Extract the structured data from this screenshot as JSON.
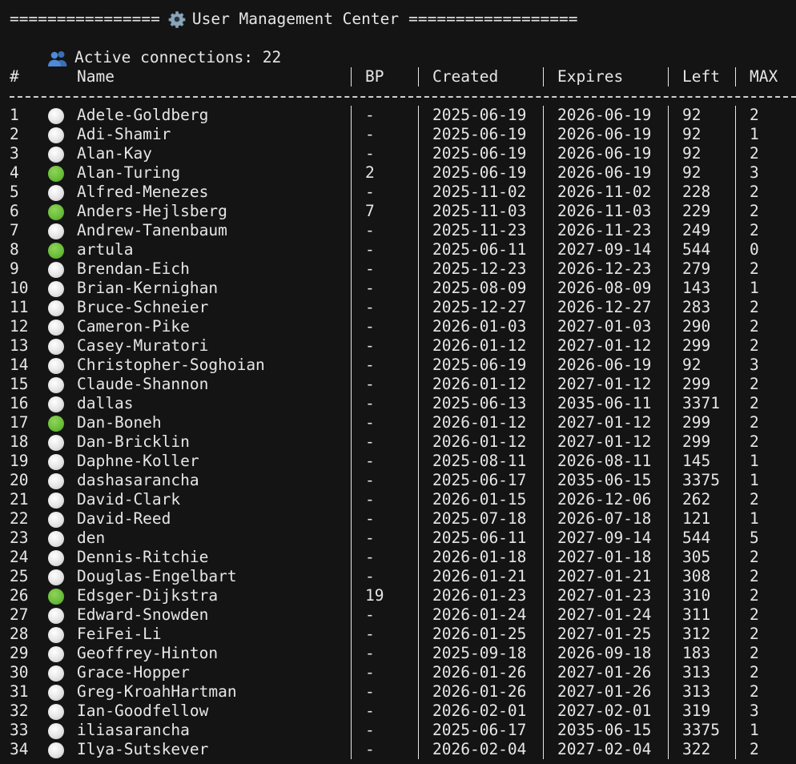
{
  "banner": {
    "left_bar": "================",
    "title": "User Management Center",
    "right_bar": "=================="
  },
  "status": {
    "text": "Active connections: 22"
  },
  "table": {
    "headers": {
      "index": "#",
      "name": "Name",
      "bp": "BP",
      "created": "Created",
      "expires": "Expires",
      "left": "Left",
      "max": "MAX"
    },
    "colors": {
      "online": "#6bbf3a",
      "offline": "#e4e4e4"
    },
    "rows": [
      {
        "idx": "1",
        "status": "offline",
        "name": "Adele-Goldberg",
        "bp": "-",
        "created": "2025-06-19",
        "expires": "2026-06-19",
        "left": "92",
        "max": "2"
      },
      {
        "idx": "2",
        "status": "offline",
        "name": "Adi-Shamir",
        "bp": "-",
        "created": "2025-06-19",
        "expires": "2026-06-19",
        "left": "92",
        "max": "1"
      },
      {
        "idx": "3",
        "status": "offline",
        "name": "Alan-Kay",
        "bp": "-",
        "created": "2025-06-19",
        "expires": "2026-06-19",
        "left": "92",
        "max": "2"
      },
      {
        "idx": "4",
        "status": "online",
        "name": "Alan-Turing",
        "bp": "2",
        "created": "2025-06-19",
        "expires": "2026-06-19",
        "left": "92",
        "max": "3"
      },
      {
        "idx": "5",
        "status": "offline",
        "name": "Alfred-Menezes",
        "bp": "-",
        "created": "2025-11-02",
        "expires": "2026-11-02",
        "left": "228",
        "max": "2"
      },
      {
        "idx": "6",
        "status": "online",
        "name": "Anders-Hejlsberg",
        "bp": "7",
        "created": "2025-11-03",
        "expires": "2026-11-03",
        "left": "229",
        "max": "2"
      },
      {
        "idx": "7",
        "status": "offline",
        "name": "Andrew-Tanenbaum",
        "bp": "-",
        "created": "2025-11-23",
        "expires": "2026-11-23",
        "left": "249",
        "max": "2"
      },
      {
        "idx": "8",
        "status": "online",
        "name": "artula",
        "bp": "-",
        "created": "2025-06-11",
        "expires": "2027-09-14",
        "left": "544",
        "max": "0"
      },
      {
        "idx": "9",
        "status": "offline",
        "name": "Brendan-Eich",
        "bp": "-",
        "created": "2025-12-23",
        "expires": "2026-12-23",
        "left": "279",
        "max": "2"
      },
      {
        "idx": "10",
        "status": "offline",
        "name": "Brian-Kernighan",
        "bp": "-",
        "created": "2025-08-09",
        "expires": "2026-08-09",
        "left": "143",
        "max": "1"
      },
      {
        "idx": "11",
        "status": "offline",
        "name": "Bruce-Schneier",
        "bp": "-",
        "created": "2025-12-27",
        "expires": "2026-12-27",
        "left": "283",
        "max": "2"
      },
      {
        "idx": "12",
        "status": "offline",
        "name": "Cameron-Pike",
        "bp": "-",
        "created": "2026-01-03",
        "expires": "2027-01-03",
        "left": "290",
        "max": "2"
      },
      {
        "idx": "13",
        "status": "offline",
        "name": "Casey-Muratori",
        "bp": "-",
        "created": "2026-01-12",
        "expires": "2027-01-12",
        "left": "299",
        "max": "2"
      },
      {
        "idx": "14",
        "status": "offline",
        "name": "Christopher-Soghoian",
        "bp": "-",
        "created": "2025-06-19",
        "expires": "2026-06-19",
        "left": "92",
        "max": "3"
      },
      {
        "idx": "15",
        "status": "offline",
        "name": "Claude-Shannon",
        "bp": "-",
        "created": "2026-01-12",
        "expires": "2027-01-12",
        "left": "299",
        "max": "2"
      },
      {
        "idx": "16",
        "status": "offline",
        "name": "dallas",
        "bp": "-",
        "created": "2025-06-13",
        "expires": "2035-06-11",
        "left": "3371",
        "max": "2"
      },
      {
        "idx": "17",
        "status": "online",
        "name": "Dan-Boneh",
        "bp": "-",
        "created": "2026-01-12",
        "expires": "2027-01-12",
        "left": "299",
        "max": "2"
      },
      {
        "idx": "18",
        "status": "offline",
        "name": "Dan-Bricklin",
        "bp": "-",
        "created": "2026-01-12",
        "expires": "2027-01-12",
        "left": "299",
        "max": "2"
      },
      {
        "idx": "19",
        "status": "offline",
        "name": "Daphne-Koller",
        "bp": "-",
        "created": "2025-08-11",
        "expires": "2026-08-11",
        "left": "145",
        "max": "1"
      },
      {
        "idx": "20",
        "status": "offline",
        "name": "dashasarancha",
        "bp": "-",
        "created": "2025-06-17",
        "expires": "2035-06-15",
        "left": "3375",
        "max": "1"
      },
      {
        "idx": "21",
        "status": "offline",
        "name": "David-Clark",
        "bp": "-",
        "created": "2026-01-15",
        "expires": "2026-12-06",
        "left": "262",
        "max": "2"
      },
      {
        "idx": "22",
        "status": "offline",
        "name": "David-Reed",
        "bp": "-",
        "created": "2025-07-18",
        "expires": "2026-07-18",
        "left": "121",
        "max": "1"
      },
      {
        "idx": "23",
        "status": "offline",
        "name": "den",
        "bp": "-",
        "created": "2025-06-11",
        "expires": "2027-09-14",
        "left": "544",
        "max": "5"
      },
      {
        "idx": "24",
        "status": "offline",
        "name": "Dennis-Ritchie",
        "bp": "-",
        "created": "2026-01-18",
        "expires": "2027-01-18",
        "left": "305",
        "max": "2"
      },
      {
        "idx": "25",
        "status": "offline",
        "name": "Douglas-Engelbart",
        "bp": "-",
        "created": "2026-01-21",
        "expires": "2027-01-21",
        "left": "308",
        "max": "2"
      },
      {
        "idx": "26",
        "status": "online",
        "name": "Edsger-Dijkstra",
        "bp": "19",
        "created": "2026-01-23",
        "expires": "2027-01-23",
        "left": "310",
        "max": "2"
      },
      {
        "idx": "27",
        "status": "offline",
        "name": "Edward-Snowden",
        "bp": "-",
        "created": "2026-01-24",
        "expires": "2027-01-24",
        "left": "311",
        "max": "2"
      },
      {
        "idx": "28",
        "status": "offline",
        "name": "FeiFei-Li",
        "bp": "-",
        "created": "2026-01-25",
        "expires": "2027-01-25",
        "left": "312",
        "max": "2"
      },
      {
        "idx": "29",
        "status": "offline",
        "name": "Geoffrey-Hinton",
        "bp": "-",
        "created": "2025-09-18",
        "expires": "2026-09-18",
        "left": "183",
        "max": "2"
      },
      {
        "idx": "30",
        "status": "offline",
        "name": "Grace-Hopper",
        "bp": "-",
        "created": "2026-01-26",
        "expires": "2027-01-26",
        "left": "313",
        "max": "2"
      },
      {
        "idx": "31",
        "status": "offline",
        "name": "Greg-KroahHartman",
        "bp": "-",
        "created": "2026-01-26",
        "expires": "2027-01-26",
        "left": "313",
        "max": "2"
      },
      {
        "idx": "32",
        "status": "offline",
        "name": "Ian-Goodfellow",
        "bp": "-",
        "created": "2026-02-01",
        "expires": "2027-02-01",
        "left": "319",
        "max": "3"
      },
      {
        "idx": "33",
        "status": "offline",
        "name": "iliasarancha",
        "bp": "-",
        "created": "2025-06-17",
        "expires": "2035-06-15",
        "left": "3375",
        "max": "1"
      },
      {
        "idx": "34",
        "status": "offline",
        "name": "Ilya-Sutskever",
        "bp": "-",
        "created": "2026-02-04",
        "expires": "2027-02-04",
        "left": "322",
        "max": "2"
      }
    ]
  }
}
